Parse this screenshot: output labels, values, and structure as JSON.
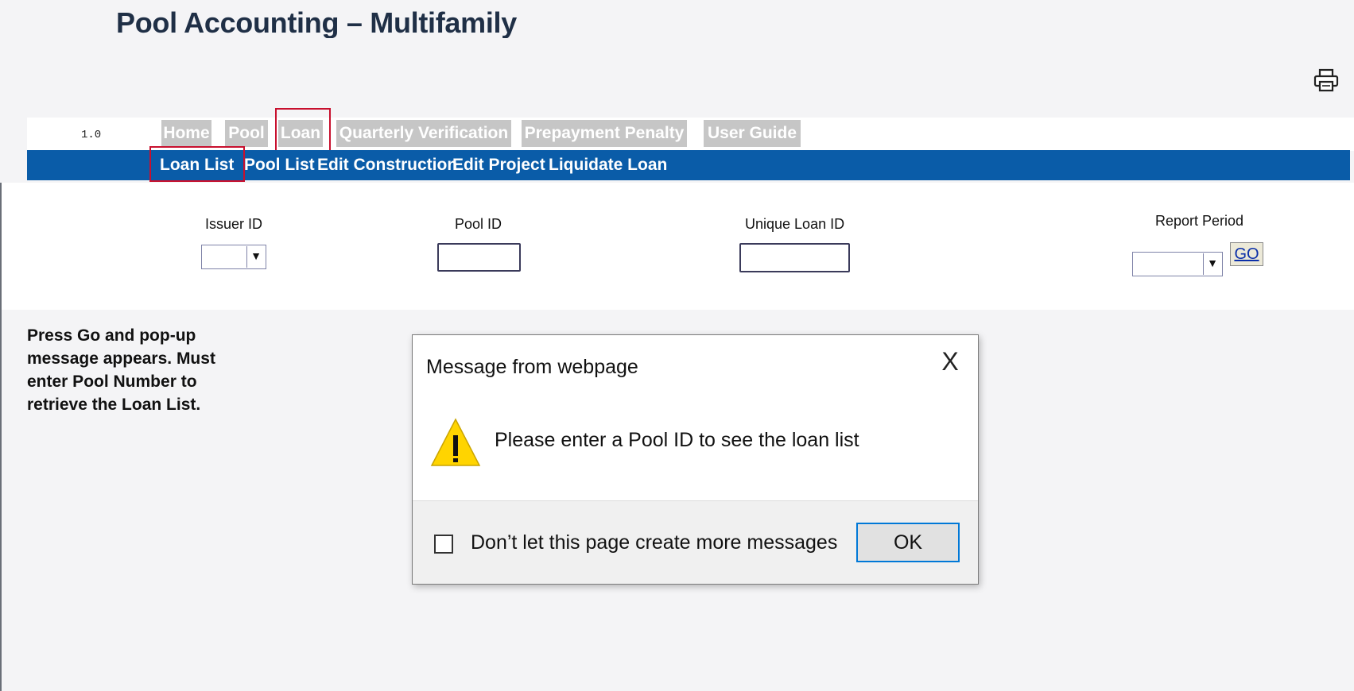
{
  "page_title": "Pool Accounting – Multifamily",
  "icons": {
    "print": "printer-icon",
    "close": "close-icon",
    "warning": "warning-icon"
  },
  "colors": {
    "subnav_bg": "#0a5ca8",
    "tab_bg": "#c6c6c6",
    "highlight_border": "#c8102e",
    "title_color": "#1f2f46",
    "ok_border": "#0078d7"
  },
  "version": "1.0",
  "nav": {
    "tabs": [
      "Home",
      "Pool",
      "Loan",
      "Quarterly Verification",
      "Prepayment Penalty",
      "User Guide"
    ],
    "selected_tab": "Loan"
  },
  "subnav": {
    "items": [
      "Loan List",
      "Pool List",
      "Edit Construction",
      "Edit Project",
      "Liquidate Loan"
    ],
    "selected_item": "Loan List"
  },
  "filters": {
    "issuer_id": {
      "label": "Issuer ID",
      "value": ""
    },
    "pool_id": {
      "label": "Pool ID",
      "value": ""
    },
    "unique_loan_id": {
      "label": "Unique Loan ID",
      "value": ""
    },
    "report_period": {
      "label": "Report Period",
      "value": ""
    },
    "go_label": "GO"
  },
  "note": "Press Go and pop-up\nmessage appears.  Must\nenter Pool Number to\nretrieve the Loan List.",
  "dialog": {
    "title": "Message from webpage",
    "close_glyph": "X",
    "message": "Please enter a Pool ID to see the loan list",
    "checkbox_label": "Don’t let this page create more messages",
    "checkbox_checked": false,
    "ok_label": "OK"
  }
}
